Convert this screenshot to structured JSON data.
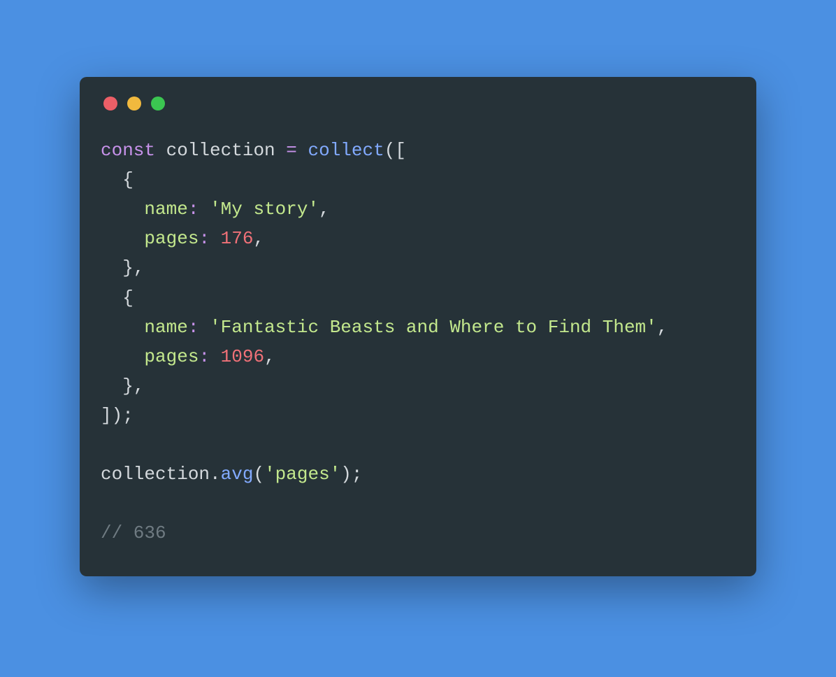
{
  "window": {
    "traffic": {
      "red": "#ec5f67",
      "yellow": "#f1b93e",
      "green": "#3bc651"
    }
  },
  "code": {
    "line1": {
      "kw_const": "const",
      "sp1": " ",
      "var_collection": "collection",
      "sp2": " ",
      "op_eq": "=",
      "sp3": " ",
      "fn_collect": "collect",
      "open": "(["
    },
    "line2": {
      "indent": "  ",
      "brace": "{"
    },
    "line3": {
      "indent": "    ",
      "prop": "name",
      "colon": ":",
      "sp": " ",
      "str": "'My story'",
      "comma": ","
    },
    "line4": {
      "indent": "    ",
      "prop": "pages",
      "colon": ":",
      "sp": " ",
      "num": "176",
      "comma": ","
    },
    "line5": {
      "indent": "  ",
      "brace": "},",
      "text": "},"
    },
    "line6": {
      "indent": "  ",
      "brace": "{"
    },
    "line7": {
      "indent": "    ",
      "prop": "name",
      "colon": ":",
      "sp": " ",
      "str": "'Fantastic Beasts and Where to Find Them'",
      "comma": ","
    },
    "line8": {
      "indent": "    ",
      "prop": "pages",
      "colon": ":",
      "sp": " ",
      "num": "1096",
      "comma": ","
    },
    "line9": {
      "indent": "  ",
      "text": "},"
    },
    "line10": {
      "text": "]);"
    },
    "blank1": "",
    "line11": {
      "obj": "collection",
      "dot": ".",
      "method": "avg",
      "open": "(",
      "arg": "'pages'",
      "close": ");"
    },
    "blank2": "",
    "line12": {
      "comment": "// 636"
    }
  }
}
